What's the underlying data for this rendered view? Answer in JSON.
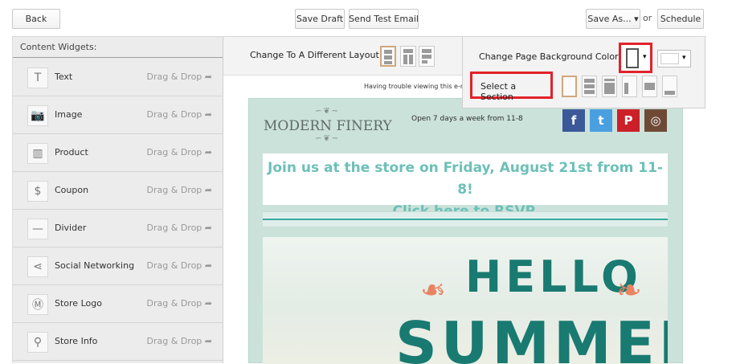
{
  "toolbar": {
    "back": "Back",
    "save_draft": "Save Draft",
    "send_test": "Send Test Email",
    "save_as": "Save As...",
    "save_as_arrow": "▾",
    "or": "or",
    "schedule": "Schedule"
  },
  "sidebar": {
    "title": "Content Widgets:",
    "drag_label": "Drag & Drop",
    "drag_arrow": "➦",
    "widgets": [
      {
        "label": "Text",
        "icon": "text-icon",
        "glyph": "T"
      },
      {
        "label": "Image",
        "icon": "camera-icon",
        "glyph": "📷"
      },
      {
        "label": "Product",
        "icon": "barcode-icon",
        "glyph": "▥"
      },
      {
        "label": "Coupon",
        "icon": "coupon-icon",
        "glyph": "$"
      },
      {
        "label": "Divider",
        "icon": "divider-icon",
        "glyph": "—"
      },
      {
        "label": "Social Networking",
        "icon": "share-icon",
        "glyph": "⋖"
      },
      {
        "label": "Store Logo",
        "icon": "store-logo-icon",
        "glyph": "Ⓜ"
      },
      {
        "label": "Store Info",
        "icon": "map-pin-icon",
        "glyph": "⚲"
      }
    ]
  },
  "layout": {
    "label": "Change To A Different Layout"
  },
  "preview": {
    "trouble_text": "Having trouble viewing this e-m",
    "store_name": "MODERN FINERY",
    "ornament": "∽❦∼",
    "hours": "Open 7 days a week from 11-8",
    "social": [
      {
        "icon": "facebook-icon",
        "glyph": "f",
        "color": "#3b5998"
      },
      {
        "icon": "twitter-icon",
        "glyph": "t",
        "color": "#4a9fe0"
      },
      {
        "icon": "pinterest-icon",
        "glyph": "P",
        "color": "#cb2027"
      },
      {
        "icon": "instagram-icon",
        "glyph": "◎",
        "color": "#6e4a36"
      }
    ],
    "promo_line1": "Join us at the store on Friday, August 21st from 11-8!",
    "promo_line2": "Click here to RSVP.",
    "hero_line1": "HELLO",
    "hero_line2": "SUMMER",
    "flourish": "❧"
  },
  "bg_panel": {
    "label": "Change Page Background Colors",
    "arrow": "▾",
    "section_label": "Select a Section"
  },
  "colors": {
    "highlight": "#e2222a",
    "email_bg": "#cbe2da",
    "teal": "#197a71",
    "promo_text": "#6dc0b8"
  }
}
